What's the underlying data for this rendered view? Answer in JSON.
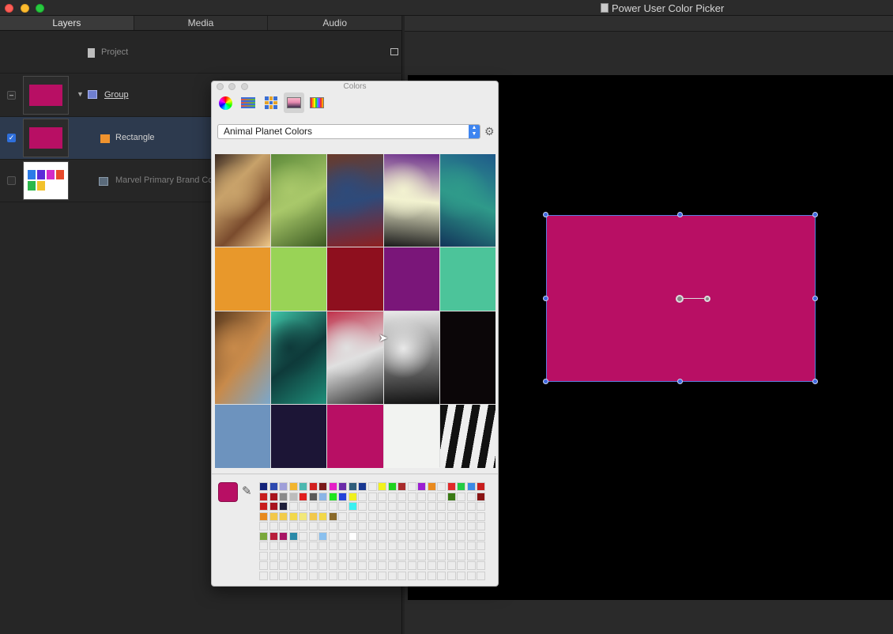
{
  "window": {
    "title": "Power User Color Picker"
  },
  "left_panel": {
    "tabs": [
      "Layers",
      "Media",
      "Audio"
    ],
    "project_label": "Project",
    "layers": [
      {
        "name": "Group",
        "checked": "mixed"
      },
      {
        "name": "Rectangle",
        "checked": true
      },
      {
        "name": "Marvel Primary Brand Co",
        "checked": false
      }
    ]
  },
  "colors_panel": {
    "title": "Colors",
    "toolbar": [
      "color-wheel",
      "color-sliders",
      "color-palettes",
      "image-palettes",
      "pencils"
    ],
    "palette_name": "Animal Planet Colors",
    "current_color": "#b80f64",
    "tiles": [
      {
        "type": "image",
        "subject": "toucan",
        "colors": [
          "#3a2a22",
          "#c8a26a",
          "#7a4b2d",
          "#f0c98a"
        ]
      },
      {
        "type": "image",
        "subject": "frog",
        "colors": [
          "#5d8a3a",
          "#a9c86a",
          "#3b5a22"
        ]
      },
      {
        "type": "image",
        "subject": "parrot",
        "colors": [
          "#6a3a2a",
          "#2e4a7a",
          "#8f2020"
        ]
      },
      {
        "type": "image",
        "subject": "butterfly",
        "colors": [
          "#6a2b8a",
          "#f2f2d0",
          "#1a1a1a"
        ]
      },
      {
        "type": "image",
        "subject": "peacock",
        "colors": [
          "#1f5a8a",
          "#2f9a8a",
          "#12345a"
        ]
      },
      {
        "type": "solid",
        "color": "#e8982b"
      },
      {
        "type": "solid",
        "color": "#99d356"
      },
      {
        "type": "solid",
        "color": "#8e0f1e"
      },
      {
        "type": "solid",
        "color": "#7a1679"
      },
      {
        "type": "solid",
        "color": "#4cc49a"
      },
      {
        "type": "image",
        "subject": "giraffes",
        "colors": [
          "#7aa7cc",
          "#c88a4a",
          "#5a3a1f"
        ]
      },
      {
        "type": "image",
        "subject": "shark",
        "colors": [
          "#1f8f7a",
          "#0e3a3a",
          "#3fc6a8"
        ]
      },
      {
        "type": "image",
        "subject": "mandrill",
        "colors": [
          "#2a2a2a",
          "#e0e0e0",
          "#c0304a"
        ]
      },
      {
        "type": "image",
        "subject": "zebra",
        "colors": [
          "#111111",
          "#e9e9e9"
        ]
      },
      {
        "type": "solid",
        "color": "#0b0608"
      },
      {
        "type": "solid",
        "color": "#6d93be"
      },
      {
        "type": "solid",
        "color": "#1c1536"
      },
      {
        "type": "solid",
        "color": "#b80f64"
      },
      {
        "type": "solid",
        "color": "#f2f3f1"
      },
      {
        "type": "stripes",
        "colors": [
          "#111111",
          "#eeeeee"
        ]
      }
    ],
    "swatches": [
      "#14237a",
      "#2d4ab0",
      "#9f9fd9",
      "#f2b52f",
      "#4db8b0",
      "#d21f1f",
      "#7a1a1a",
      "#e61ec7",
      "#6b2ba8",
      "#2f5d7a",
      "#173791",
      "#ececec",
      "#f2f21e",
      "#1ed21e",
      "#a82b2b",
      "#ececec",
      "#9b1ed2",
      "#e98a1e",
      "#ececec",
      "#e02a2a",
      "#22cc44",
      "#3b8ae6",
      "#c81e1e",
      "#c81e1e",
      "#a8141e",
      "#8a8a8a",
      "#bcbcbc",
      "#e11e1e",
      "#5a5a5a",
      "#8ab4e6",
      "#1ee61e",
      "#2343d9",
      "#f0f01e",
      "#ececec",
      "#ececec",
      "#ececec",
      "#ececec",
      "#ececec",
      "#ececec",
      "#ececec",
      "#ececec",
      "#ececec",
      "#3a7a14",
      "#ececec",
      "#ececec",
      "#8a1414",
      "#c81e1e",
      "#a8141e",
      "#1e1e3a",
      "#ececec",
      "#ececec",
      "#ececec",
      "#ececec",
      "#ececec",
      "#ececec",
      "#3af0f0",
      "#ececec",
      "#ececec",
      "#ececec",
      "#ececec",
      "#ececec",
      "#ececec",
      "#ececec",
      "#ececec",
      "#ececec",
      "#ececec",
      "#ececec",
      "#ececec",
      "#ececec",
      "#e88a1e",
      "#f2c84a",
      "#f2cc4a",
      "#f2d84a",
      "#f2e87a",
      "#f2c84a",
      "#f2d84a",
      "#8a6a2a",
      "#ececec",
      "#ececec",
      "#ececec",
      "#ececec",
      "#ececec",
      "#ececec",
      "#ececec",
      "#ececec",
      "#ececec",
      "#ececec",
      "#ececec",
      "#ececec",
      "#ececec",
      "#ececec",
      "#ececec",
      "#ececec",
      "#ececec",
      "#ececec",
      "#ececec",
      "#ececec",
      "#ececec",
      "#ececec",
      "#ececec",
      "#ececec",
      "#ececec",
      "#ececec",
      "#ececec",
      "#ececec",
      "#ececec",
      "#ececec",
      "#ececec",
      "#ececec",
      "#ececec",
      "#ececec",
      "#ececec",
      "#ececec",
      "#ececec",
      "#ececec",
      "#7aa83a",
      "#b81e3a",
      "#a81464",
      "#2a8aa8",
      "#ececec",
      "#ececec",
      "#8ac0ee",
      "#ececec",
      "#ececec",
      "#ffffff",
      "#ececec",
      "#ececec",
      "#ececec",
      "#ececec",
      "#ececec",
      "#ececec",
      "#ececec",
      "#ececec",
      "#ececec",
      "#ececec",
      "#ececec",
      "#ececec",
      "#ececec"
    ]
  },
  "canvas": {
    "fill": "#b80f64"
  }
}
